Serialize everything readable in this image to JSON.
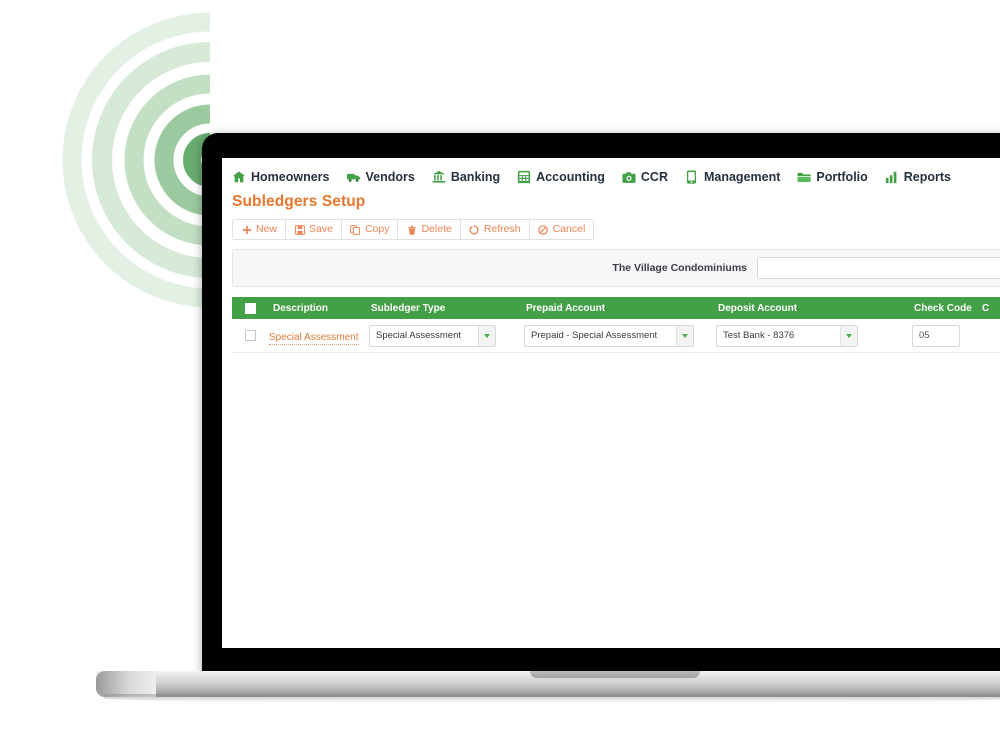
{
  "app": {
    "page_title": "Subledgers Setup",
    "brand_green": "#43a047",
    "brand_orange": "#e8762d",
    "toolbar_orange": "#ef8354"
  },
  "nav": {
    "items": [
      {
        "label": "Homeowners",
        "icon": "home-icon"
      },
      {
        "label": "Vendors",
        "icon": "truck-icon"
      },
      {
        "label": "Banking",
        "icon": "bank-icon"
      },
      {
        "label": "Accounting",
        "icon": "calculator-icon"
      },
      {
        "label": "CCR",
        "icon": "camera-icon"
      },
      {
        "label": "Management",
        "icon": "mobile-icon"
      },
      {
        "label": "Portfolio",
        "icon": "folder-icon"
      },
      {
        "label": "Reports",
        "icon": "bar-chart-icon"
      }
    ]
  },
  "toolbar": {
    "buttons": [
      {
        "label": "New",
        "icon": "plus-icon"
      },
      {
        "label": "Save",
        "icon": "save-icon"
      },
      {
        "label": "Copy",
        "icon": "copy-icon"
      },
      {
        "label": "Delete",
        "icon": "trash-icon"
      },
      {
        "label": "Refresh",
        "icon": "refresh-icon"
      },
      {
        "label": "Cancel",
        "icon": "cancel-icon"
      }
    ]
  },
  "filter": {
    "label": "The Village Condominiums",
    "input_value": "",
    "input_placeholder": ""
  },
  "grid": {
    "columns": [
      {
        "key": "select",
        "label": ""
      },
      {
        "key": "description",
        "label": "Description"
      },
      {
        "key": "subledger_type",
        "label": "Subledger Type"
      },
      {
        "key": "prepaid_account",
        "label": "Prepaid Account"
      },
      {
        "key": "deposit_account",
        "label": "Deposit Account"
      },
      {
        "key": "check_code",
        "label": "Check Code"
      },
      {
        "key": "status",
        "label": "C"
      }
    ],
    "rows": [
      {
        "description": "Special Assessment",
        "subledger_type": "Special Assessment",
        "prepaid_account": "Prepaid - Special Assessment",
        "deposit_account": "Test Bank - 8376",
        "check_code": "05",
        "status": "active"
      }
    ]
  }
}
